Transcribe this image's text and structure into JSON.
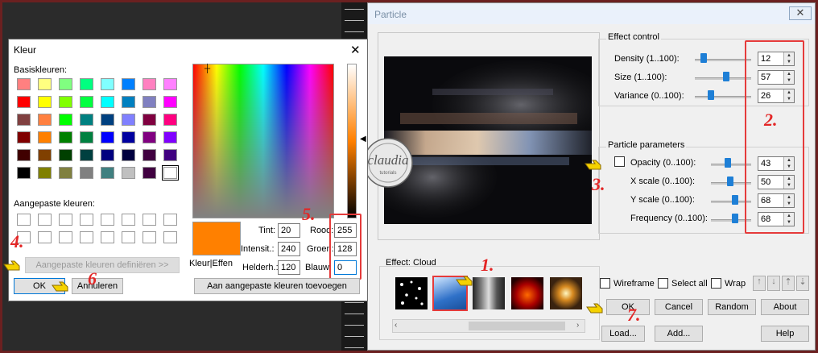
{
  "particle": {
    "title": "Particle",
    "close_label": "✕",
    "effect_control": {
      "title": "Effect control",
      "rows": [
        {
          "label": "Density (1..100):",
          "value": "12",
          "level": 12
        },
        {
          "label": "Size (1..100):",
          "value": "57",
          "level": 57
        },
        {
          "label": "Variance (0..100):",
          "value": "26",
          "level": 26
        }
      ]
    },
    "particle_params": {
      "title": "Particle parameters",
      "rows": [
        {
          "label": "Opacity (0..100):",
          "value": "43",
          "level": 43
        },
        {
          "label": "X scale (0..100):",
          "value": "50",
          "level": 50
        },
        {
          "label": "Y scale (0..100):",
          "value": "68",
          "level": 68
        },
        {
          "label": "Frequency (0..100):",
          "value": "68",
          "level": 68
        }
      ]
    },
    "effect_label": "Effect: Cloud",
    "watermark": {
      "text": "claudia",
      "subtext": "tutorials"
    },
    "checks": {
      "wireframe": "Wireframe",
      "select_all": "Select all",
      "wrap": "Wrap"
    },
    "buttons": {
      "ok": "OK",
      "cancel": "Cancel",
      "random": "Random",
      "about": "About",
      "load": "Load...",
      "add": "Add...",
      "help": "Help"
    },
    "annotations": {
      "n1": "1.",
      "n2": "2.",
      "n3": "3.",
      "n7": "7."
    }
  },
  "kleur": {
    "title": "Kleur",
    "close_label": "✕",
    "basic_label": "Basiskleuren:",
    "basic_colors": [
      "#ff8080",
      "#ffff80",
      "#80ff80",
      "#00ff80",
      "#80ffff",
      "#0080ff",
      "#ff80c0",
      "#ff80ff",
      "#ff0000",
      "#ffff00",
      "#80ff00",
      "#00ff40",
      "#00ffff",
      "#0080c0",
      "#8080c0",
      "#ff00ff",
      "#804040",
      "#ff8040",
      "#00ff00",
      "#008080",
      "#004080",
      "#8080ff",
      "#800040",
      "#ff0080",
      "#800000",
      "#ff8000",
      "#008000",
      "#008040",
      "#0000ff",
      "#0000a0",
      "#800080",
      "#8000ff",
      "#400000",
      "#804000",
      "#004000",
      "#004040",
      "#000080",
      "#000040",
      "#400040",
      "#400080",
      "#000000",
      "#808000",
      "#808040",
      "#808080",
      "#408080",
      "#c0c0c0",
      "#400040",
      "#ffffff"
    ],
    "custom_label": "Aangepaste kleuren:",
    "define_button": "Aangepaste kleuren definiëren >>",
    "ok_button": "OK",
    "cancel_button": "Annuleren",
    "add_custom_button": "Aan aangepaste kleuren toevoegen",
    "color_solid_label": "Kleur|Effen",
    "selected_color": "#ff8000",
    "fields": {
      "tint": {
        "label": "Tint:",
        "value": "20"
      },
      "sat": {
        "label": "Intensit.:",
        "value": "240"
      },
      "lum": {
        "label": "Helderh.:",
        "value": "120"
      },
      "red": {
        "label": "Rood:",
        "value": "255"
      },
      "green": {
        "label": "Groen:",
        "value": "128"
      },
      "blue": {
        "label": "Blauw:",
        "value": "0"
      }
    },
    "annotations": {
      "n4": "4.",
      "n5": "5.",
      "n6": "6"
    }
  }
}
